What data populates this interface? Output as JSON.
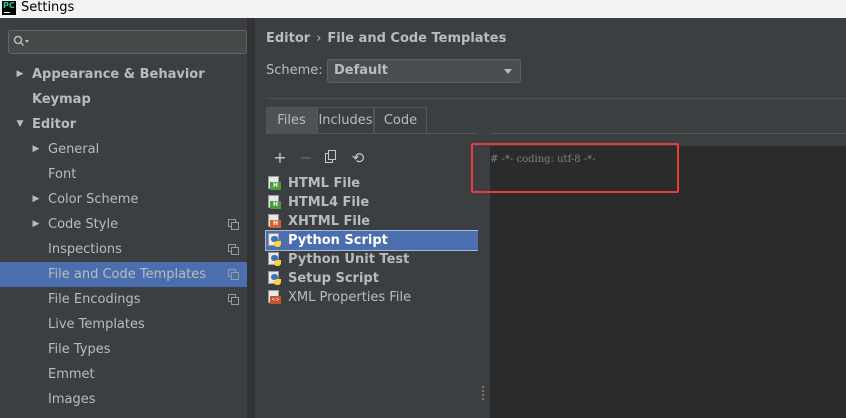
{
  "window": {
    "title": "Settings",
    "app_badge": "PC"
  },
  "search": {
    "placeholder": "",
    "icon": "search-icon"
  },
  "sidebar": {
    "items": [
      {
        "label": "Appearance & Behavior",
        "bold": true,
        "arrow": "right",
        "level": 0
      },
      {
        "label": "Keymap",
        "bold": true,
        "arrow": "",
        "level": 0
      },
      {
        "label": "Editor",
        "bold": true,
        "arrow": "down",
        "level": 0
      },
      {
        "label": "General",
        "bold": false,
        "arrow": "right",
        "level": 1
      },
      {
        "label": "Font",
        "bold": false,
        "arrow": "",
        "level": 1
      },
      {
        "label": "Color Scheme",
        "bold": false,
        "arrow": "right",
        "level": 1
      },
      {
        "label": "Code Style",
        "bold": false,
        "arrow": "right",
        "level": 1,
        "project_icon": true
      },
      {
        "label": "Inspections",
        "bold": false,
        "arrow": "",
        "level": 1,
        "project_icon": true
      },
      {
        "label": "File and Code Templates",
        "bold": false,
        "arrow": "",
        "level": 1,
        "project_icon": true,
        "selected": true
      },
      {
        "label": "File Encodings",
        "bold": false,
        "arrow": "",
        "level": 1,
        "project_icon": true
      },
      {
        "label": "Live Templates",
        "bold": false,
        "arrow": "",
        "level": 1
      },
      {
        "label": "File Types",
        "bold": false,
        "arrow": "",
        "level": 1
      },
      {
        "label": "Emmet",
        "bold": false,
        "arrow": "",
        "level": 1
      },
      {
        "label": "Images",
        "bold": false,
        "arrow": "",
        "level": 1
      }
    ]
  },
  "breadcrumb": {
    "parent": "Editor",
    "separator": "›",
    "current": "File and Code Templates"
  },
  "scheme": {
    "label": "Scheme:",
    "value": "Default"
  },
  "tabs": [
    {
      "label": "Files",
      "active": true
    },
    {
      "label": "Includes",
      "active": false
    },
    {
      "label": "Code",
      "active": false
    }
  ],
  "toolbar": {
    "add": "+",
    "remove": "−",
    "copy": "copy-icon",
    "reset": "⟲"
  },
  "templates": [
    {
      "name": "HTML File",
      "icon": "html-file-icon",
      "bold": true
    },
    {
      "name": "HTML4 File",
      "icon": "html-file-icon",
      "bold": true
    },
    {
      "name": "XHTML File",
      "icon": "xhtml-file-icon",
      "bold": true
    },
    {
      "name": "Python Script",
      "icon": "python-file-icon",
      "bold": true,
      "selected": true
    },
    {
      "name": "Python Unit Test",
      "icon": "python-file-icon",
      "bold": true
    },
    {
      "name": "Setup Script",
      "icon": "python-file-icon",
      "bold": true
    },
    {
      "name": "XML Properties File",
      "icon": "xml-file-icon",
      "bold": false
    }
  ],
  "editor": {
    "code": "# -*- coding: utf-8 -*-"
  },
  "colors": {
    "background": "#3c3f41",
    "selection": "#4b6eaf",
    "editor_bg": "#2b2b2b",
    "highlight": "#e53c3c"
  }
}
